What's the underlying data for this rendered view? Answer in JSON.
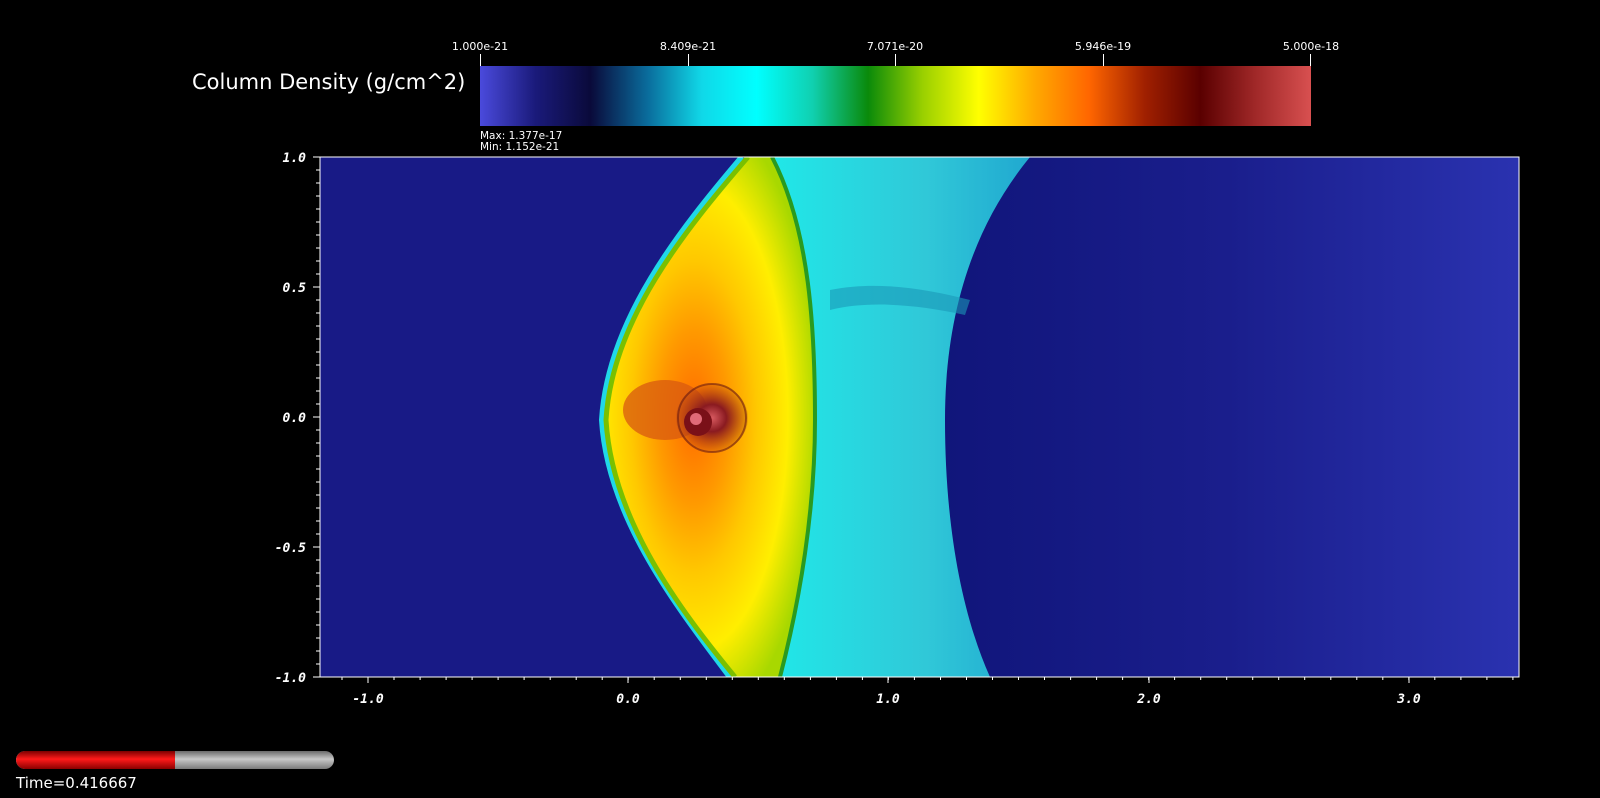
{
  "legend": {
    "title": "Column Density (g/cm^2)",
    "ticks": [
      "1.000e-21",
      "8.409e-21",
      "7.071e-20",
      "5.946e-19",
      "5.000e-18"
    ],
    "max_label": "Max:  1.377e-17",
    "min_label": "Min:  1.152e-21",
    "colormap": [
      "#4a4adc",
      "#1a1a7a",
      "#0a0a3a",
      "#0a6a9a",
      "#10d8e8",
      "#00ffff",
      "#10d0b0",
      "#0a8a0a",
      "#9ad000",
      "#ffff00",
      "#ffaa00",
      "#ff6600",
      "#a02000",
      "#5a0000",
      "#a02828",
      "#d85050"
    ]
  },
  "axes": {
    "x_ticks": [
      "-1.0",
      "0.0",
      "1.0",
      "2.0",
      "3.0"
    ],
    "y_ticks": [
      "1.0",
      "0.5",
      "0.0",
      "-0.5",
      "-1.0"
    ]
  },
  "time": {
    "label": "Time=0.416667",
    "progress": 0.5
  },
  "colors": {
    "background_medium": "#181a86",
    "deep_blue": "#141a7a",
    "shock_cyan": "#1ad8e0",
    "shell_yellow": "#ffd000",
    "core_orange": "#ff7a10",
    "clump_red": "#8a2020"
  }
}
